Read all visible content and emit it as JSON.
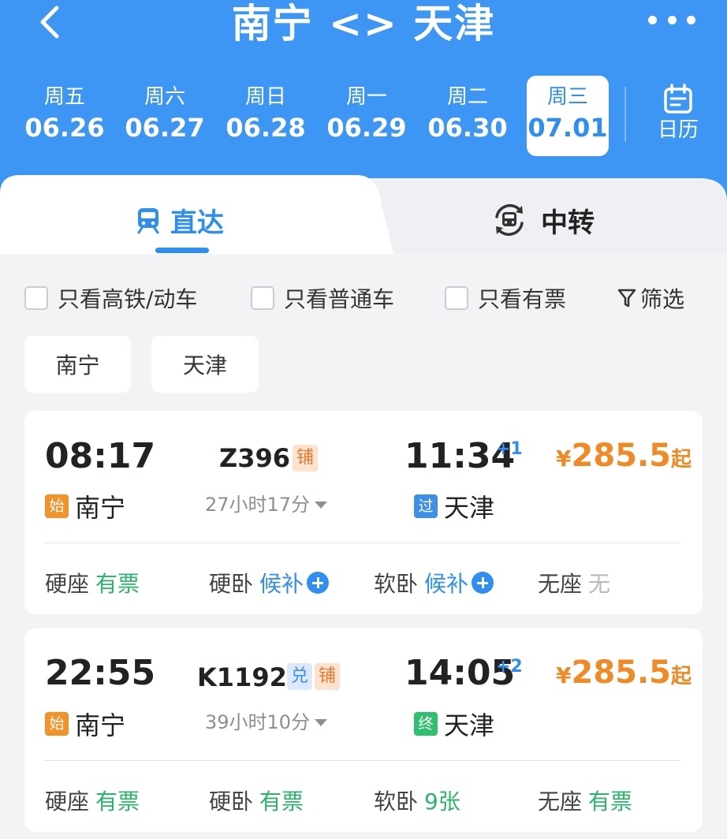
{
  "header": {
    "title": "南宁 <> 天津",
    "back_icon": "chevron-left-icon",
    "more_icon": "more-dots-icon"
  },
  "dates": [
    {
      "weekday": "周五",
      "date": "06.26",
      "active": false
    },
    {
      "weekday": "周六",
      "date": "06.27",
      "active": false
    },
    {
      "weekday": "周日",
      "date": "06.28",
      "active": false
    },
    {
      "weekday": "周一",
      "date": "06.29",
      "active": false
    },
    {
      "weekday": "周二",
      "date": "06.30",
      "active": false
    },
    {
      "weekday": "周三",
      "date": "07.01",
      "active": true
    }
  ],
  "calendar": {
    "label": "日历",
    "icon": "calendar-icon"
  },
  "tabs": {
    "direct": {
      "label": "直达",
      "icon": "train-icon",
      "active": true
    },
    "transfer": {
      "label": "中转",
      "icon": "transfer-icon",
      "active": false
    }
  },
  "filters": {
    "high_speed": "只看高铁/动车",
    "normal": "只看普通车",
    "available": "只看有票",
    "filter_label": "筛选",
    "filter_icon": "funnel-icon"
  },
  "stations": {
    "from": "南宁",
    "to": "天津"
  },
  "trains": [
    {
      "depart": "08:17",
      "train_no": "Z396",
      "badges": [
        {
          "text": "铺",
          "kind": "pu"
        }
      ],
      "duration": "27小时17分",
      "arrive": "11:34",
      "day_offset": "+1",
      "price_symbol": "¥",
      "price": "285.5",
      "price_suffix": "起",
      "from_tag": "始",
      "from": "南宁",
      "to_tag": "过",
      "to": "天津",
      "seats": [
        {
          "name": "硬座",
          "status": "有票",
          "tone": "green",
          "plus": false
        },
        {
          "name": "硬卧",
          "status": "候补",
          "tone": "blue",
          "plus": true
        },
        {
          "name": "软卧",
          "status": "候补",
          "tone": "blue",
          "plus": true
        },
        {
          "name": "无座",
          "status": "无",
          "tone": "gray",
          "plus": false
        }
      ]
    },
    {
      "depart": "22:55",
      "train_no": "K1192",
      "badges": [
        {
          "text": "兑",
          "kind": "dui"
        },
        {
          "text": "铺",
          "kind": "pu"
        }
      ],
      "duration": "39小时10分",
      "arrive": "14:05",
      "day_offset": "+2",
      "price_symbol": "¥",
      "price": "285.5",
      "price_suffix": "起",
      "from_tag": "始",
      "from": "南宁",
      "to_tag": "终",
      "to": "天津",
      "seats": [
        {
          "name": "硬座",
          "status": "有票",
          "tone": "green",
          "plus": false
        },
        {
          "name": "硬卧",
          "status": "有票",
          "tone": "green",
          "plus": false
        },
        {
          "name": "软卧",
          "status": "9张",
          "tone": "green",
          "plus": false
        },
        {
          "name": "无座",
          "status": "有票",
          "tone": "green",
          "plus": false
        }
      ]
    }
  ],
  "colors": {
    "header_blue": "#3d96f3",
    "accent_blue": "#2f8ef2",
    "price_orange": "#f08a24",
    "available_green": "#2db36a"
  }
}
